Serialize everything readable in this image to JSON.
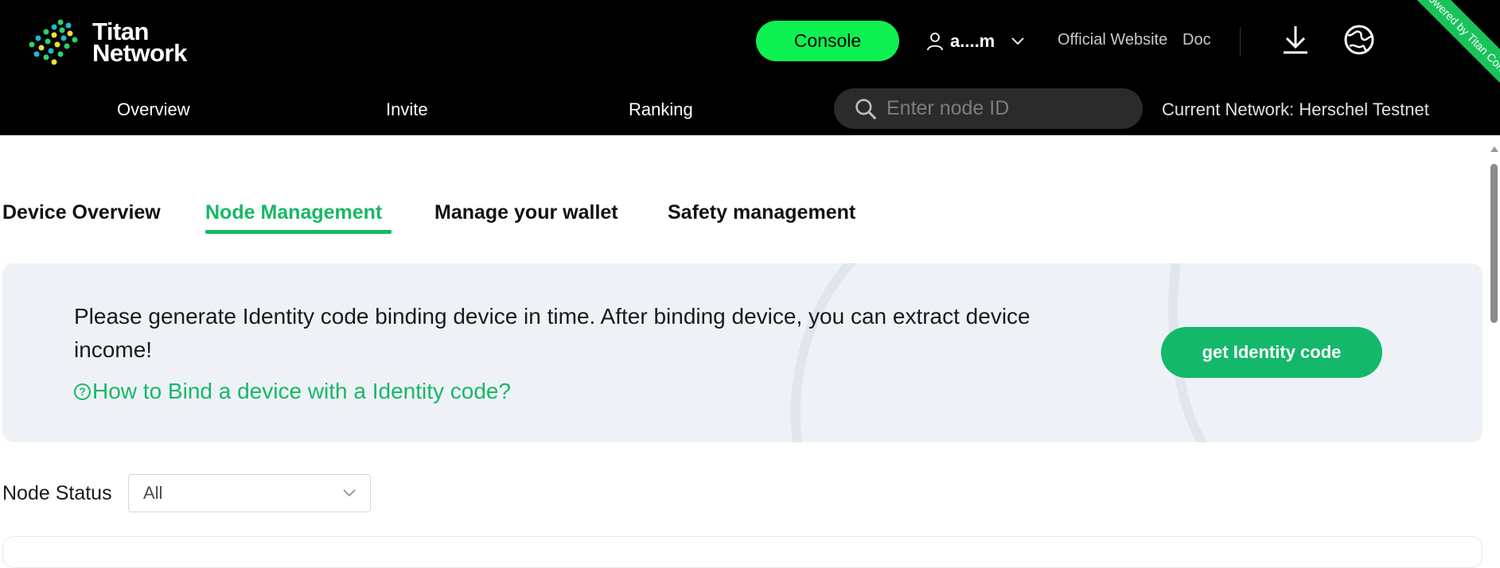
{
  "brand": {
    "line1": "Titan",
    "line2": "Network"
  },
  "header": {
    "console_label": "Console",
    "user_name": "a....m",
    "links": [
      "Official Website",
      "Doc"
    ],
    "ribbon_text": "Powered by Titan Containers"
  },
  "nav": {
    "items": [
      "Overview",
      "Invite",
      "Ranking"
    ],
    "search_placeholder": "Enter node ID",
    "current_network": "Current Network: Herschel Testnet"
  },
  "tabs": [
    {
      "label": "Device Overview",
      "active": false
    },
    {
      "label": "Node Management",
      "active": true
    },
    {
      "label": "Manage your wallet",
      "active": false
    },
    {
      "label": "Safety management",
      "active": false
    }
  ],
  "banner": {
    "message": "Please generate Identity code binding device in time. After binding device, you can extract device income!",
    "help_link": "How to Bind a device with a Identity code?",
    "button_label": "get Identity code"
  },
  "filter": {
    "label": "Node Status",
    "selected": "All"
  },
  "colors": {
    "accent_green": "#17b865",
    "console_green": "#0ef152",
    "header_bg": "#000000",
    "banner_bg": "#eef2f7"
  },
  "icons": [
    "titan-logo-icon",
    "user-icon",
    "chevron-down-icon",
    "download-icon",
    "globe-icon",
    "search-icon",
    "help-icon"
  ]
}
